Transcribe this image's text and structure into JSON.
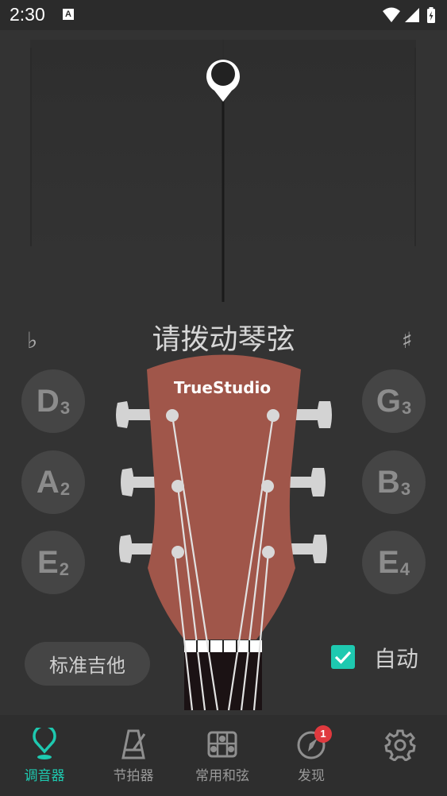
{
  "status_bar": {
    "time": "2:30",
    "notification_icon": "A"
  },
  "tuner": {
    "prompt": "请拨动琴弦",
    "flat_symbol": "♭",
    "sharp_symbol": "♯",
    "strings_left": [
      {
        "letter": "D",
        "octave": "3"
      },
      {
        "letter": "A",
        "octave": "2"
      },
      {
        "letter": "E",
        "octave": "2"
      }
    ],
    "strings_right": [
      {
        "letter": "G",
        "octave": "3"
      },
      {
        "letter": "B",
        "octave": "3"
      },
      {
        "letter": "E",
        "octave": "4"
      }
    ]
  },
  "headstock": {
    "brand": "TrueStudio",
    "color": "#a0564a"
  },
  "controls": {
    "tuning_label": "标准吉他",
    "auto_label": "自动",
    "auto_checked": true
  },
  "accent_color": "#1ec9b0",
  "bottom_nav": {
    "items": [
      {
        "label": "调音器",
        "icon": "tuner-pin-icon",
        "active": true
      },
      {
        "label": "节拍器",
        "icon": "metronome-icon"
      },
      {
        "label": "常用和弦",
        "icon": "chord-icon"
      },
      {
        "label": "发现",
        "icon": "compass-icon",
        "badge": "1"
      },
      {
        "label": "",
        "icon": "gear-icon"
      }
    ]
  }
}
